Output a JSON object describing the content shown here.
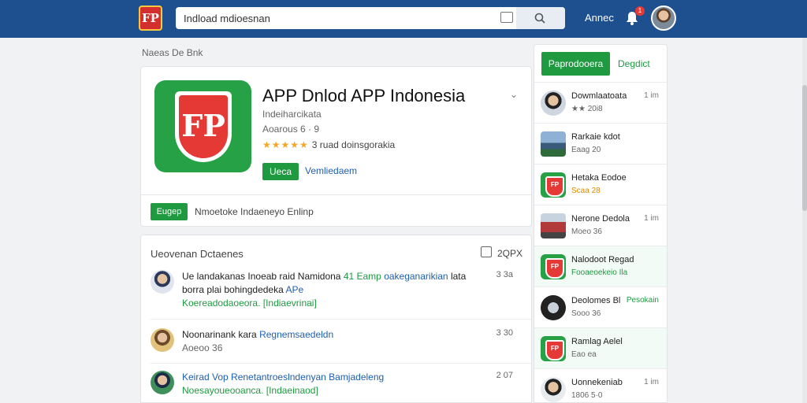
{
  "header": {
    "search_value": "Indload mdioesnan",
    "top_link": "Annec",
    "notification_count": "1"
  },
  "breadcrumb": "Naeas  De Bnk",
  "app": {
    "title": "APP Dnlod APP Indonesia",
    "developer": "Indeiharcikata",
    "meta": "Aoarous 6 · 9",
    "stars": "★★★★★",
    "rating_text": "3 ruad doinsgorakia",
    "install_label": "Ueca",
    "wishlist_label": "Vemliedaem",
    "promo_button": "Eugep",
    "promo_text": "Nmoetoke Indaeneyo Enlinp"
  },
  "reviews": {
    "title": "Ueovenan Dctaenes",
    "count": "2QPX",
    "items": [
      {
        "line1": "Ue landakanas Inoeab raid Namidona",
        "line1_green": "41 Eamp",
        "line1_blue": "oakeganarikian",
        "line1_end": "lata",
        "line2": "borra plai bohingdedeka",
        "line2_blue": "APe",
        "line3": "Koereadodaoeora. [Indiaevrinai]",
        "time": "3 3a"
      },
      {
        "line1": "Noonarinank kara",
        "line1_blue": "Regnemsaedeldn",
        "line2": "Aoeoo 36",
        "time": "3 30"
      },
      {
        "line1": "Keirad Vop Renetantroeslndenyan Bamjadeleng",
        "line2": "Noesayoueooanca. [Indaeinaod]",
        "time": "2 07"
      }
    ]
  },
  "sidebar": {
    "primary_label": "Paprodooera",
    "secondary_label": "Degdict",
    "items": [
      {
        "name": "Dowmlaatoata",
        "sub": "★★ 20i8",
        "time": "1 im"
      },
      {
        "name": "Rarkaie kdot",
        "sub": "Eaag 20",
        "time": ""
      },
      {
        "name": "Hetaka Eodoe",
        "sub": "Scaa 28",
        "time": ""
      },
      {
        "name": "Nerone Dedola",
        "sub": "Moeo 36",
        "time": "1 im"
      },
      {
        "name": "Nalodoot Regad",
        "sub": "Fooaeoekeio Ila",
        "time": ""
      },
      {
        "name": "Deolomes Bl",
        "sub": "Sooo 36",
        "time": "Pesokain"
      },
      {
        "name": "Ramlag Aelel",
        "sub": "Eao ea",
        "time": ""
      },
      {
        "name": "Uonnekeniab",
        "sub": "1806 5·0",
        "time": "1 im"
      }
    ]
  },
  "colors": {
    "topbar": "#1e4f8f",
    "accent": "#1f9a41",
    "link": "#1e5fb0",
    "star": "#f5a623",
    "logo_red": "#e53935"
  },
  "icons": [
    "logo-icon",
    "clipboard-icon",
    "search-icon",
    "bell-icon",
    "share-icon",
    "chevron-down-icon"
  ]
}
